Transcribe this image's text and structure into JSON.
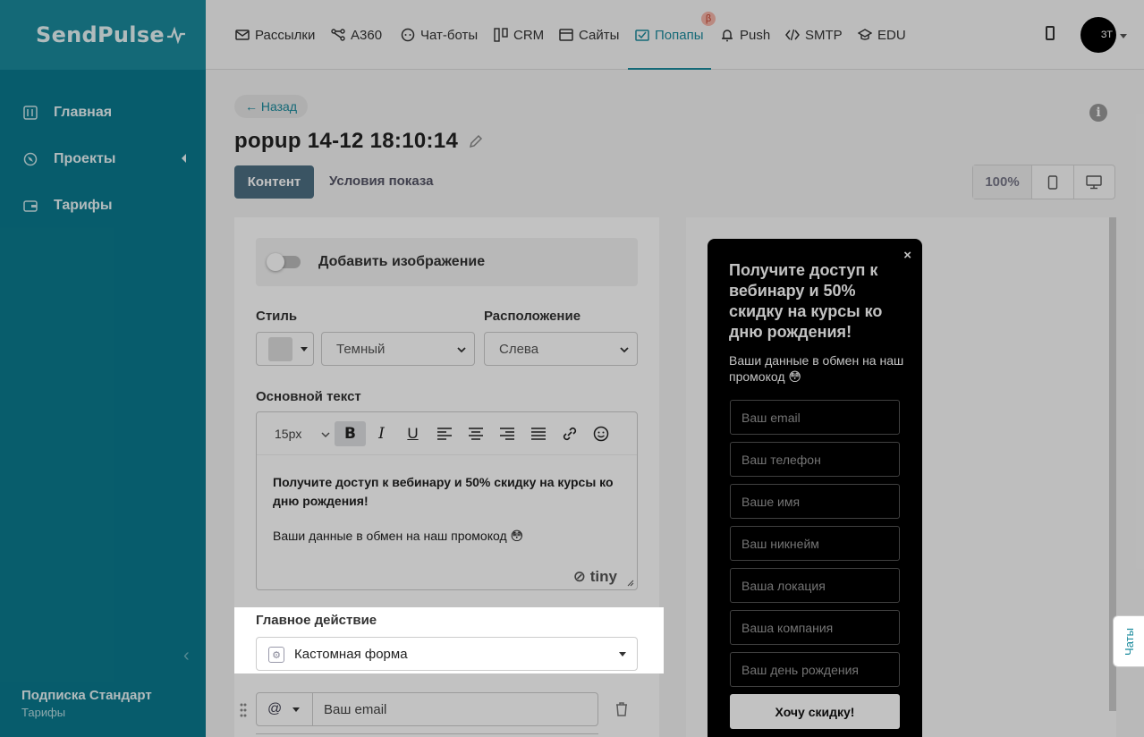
{
  "brand": {
    "logo_text": "SendPulse"
  },
  "sidebar": {
    "items": [
      {
        "label": "Главная",
        "icon": "dashboard-icon"
      },
      {
        "label": "Проекты",
        "icon": "projects-icon"
      },
      {
        "label": "Тарифы",
        "icon": "wallet-icon"
      }
    ],
    "plan": {
      "title": "Подписка Стандарт",
      "subtitle": "Тарифы"
    }
  },
  "topnav": {
    "items": [
      {
        "label": "Рассылки",
        "icon": "mail-icon"
      },
      {
        "label": "A360",
        "icon": "automation-icon"
      },
      {
        "label": "Чат-боты",
        "icon": "chatbot-icon"
      },
      {
        "label": "CRM",
        "icon": "crm-icon"
      },
      {
        "label": "Сайты",
        "icon": "sites-icon"
      },
      {
        "label": "Попапы",
        "icon": "popup-icon",
        "active": true,
        "badge": "β"
      },
      {
        "label": "Push",
        "icon": "bell-icon"
      },
      {
        "label": "SMTP",
        "icon": "code-icon"
      },
      {
        "label": "EDU",
        "icon": "graduation-icon"
      }
    ],
    "avatar_text": "ЗТ"
  },
  "page": {
    "back_label": "← Назад",
    "title": "popup 14-12 18:10:14",
    "tabs": {
      "content": "Контент",
      "conditions": "Условия показа"
    },
    "zoom": "100%"
  },
  "editor": {
    "add_image_label": "Добавить изображение",
    "style_label": "Стиль",
    "style_value": "Темный",
    "position_label": "Расположение",
    "position_value": "Слева",
    "main_text_label": "Основной текст",
    "font_size": "15px",
    "body_bold": "Получите доступ к вебинару и 50% скидку на курсы ко дню рождения!",
    "body_text": "Ваши данные в обмен на наш промокод 😳",
    "tiny_label": "tiny",
    "main_action_label": "Главное действие",
    "main_action_value": "Кастомная форма",
    "field_icon": "@",
    "field_value": "Ваш email"
  },
  "popup": {
    "close": "×",
    "heading": "Получите доступ к вебинару и 50% скидку на курсы ко дню рождения!",
    "subtext": "Ваши данные в обмен на наш промокод 😳",
    "fields": [
      "Ваш email",
      "Ваш телефон",
      "Ваше имя",
      "Ваш никнейм",
      "Ваша локация",
      "Ваша компания",
      "Ваш день рождения"
    ],
    "button": "Хочу скидку!"
  },
  "chats_tab": "Чаты",
  "colors": {
    "sidebar": "#0a7a8e",
    "accent": "#1b8b9d",
    "tab_active": "#4d6f83"
  }
}
